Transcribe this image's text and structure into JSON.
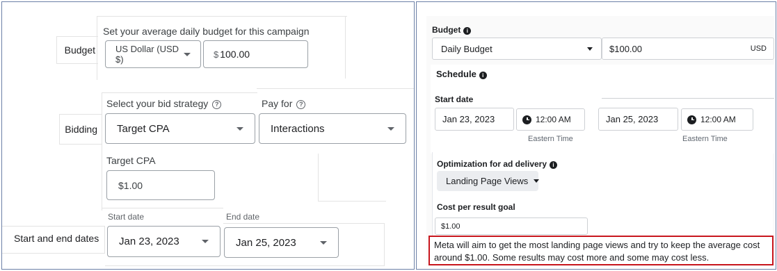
{
  "google": {
    "budget": {
      "row_label": "Budget",
      "heading": "Set your average daily budget for this campaign",
      "currency": "US Dollar (USD $)",
      "amount_symbol": "$",
      "amount_value": "100.00"
    },
    "bidding": {
      "row_label": "Bidding",
      "strategy_heading": "Select your bid strategy",
      "strategy_value": "Target CPA",
      "pay_for_heading": "Pay for",
      "pay_for_value": "Interactions",
      "target_cpa_label": "Target CPA",
      "target_cpa_value": "$1.00"
    },
    "dates": {
      "row_label": "Start and end dates",
      "start_label": "Start date",
      "start_value": "Jan 23, 2023",
      "end_label": "End date",
      "end_value": "Jan 25, 2023"
    }
  },
  "meta": {
    "budget": {
      "heading": "Budget",
      "type_value": "Daily Budget",
      "amount_value": "$100.00",
      "currency": "USD"
    },
    "schedule": {
      "heading": "Schedule",
      "start_date_heading": "Start date",
      "start_date_value": "Jan 23, 2023",
      "start_time_value": "12:00 AM",
      "start_timezone": "Eastern Time",
      "end_date_value": "Jan 25, 2023",
      "end_time_value": "12:00 AM",
      "end_timezone": "Eastern Time"
    },
    "optimization": {
      "heading": "Optimization for ad delivery",
      "value": "Landing Page Views"
    },
    "cost_goal": {
      "heading": "Cost per result goal",
      "value": "$1.00",
      "notice": "Meta will aim to get the most landing page views and try to keep the average cost around $1.00. Some results may cost more and some may cost less."
    }
  },
  "colors": {
    "frame": "#6b7fa6",
    "notice_border": "#c8161d"
  }
}
